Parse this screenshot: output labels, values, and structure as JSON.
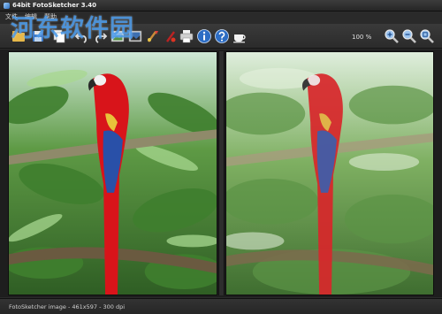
{
  "window": {
    "title": "64bit FotoSketcher 3.40"
  },
  "watermark": {
    "text": "河东软件园"
  },
  "menu": {
    "items": [
      "文件",
      "编辑",
      "帮助"
    ]
  },
  "toolbar": {
    "icons": [
      "open-icon",
      "save-icon",
      "copy-icon",
      "undo-icon",
      "redo-icon",
      "image-icon",
      "photo-icon",
      "brush-icon",
      "paint-icon",
      "print-icon",
      "info-icon",
      "help-icon",
      "coffee-icon",
      "zoom-in-icon",
      "zoom-out-icon",
      "zoom-fit-icon"
    ],
    "zoom_level": "100 %"
  },
  "status": {
    "text": "FotoSketcher image - 461x597 - 300 dpi"
  },
  "colors": {
    "background": "#2a2a2a",
    "accent": "#4696e6",
    "parrot_red": "#d8141a",
    "parrot_blue": "#2950a8"
  }
}
